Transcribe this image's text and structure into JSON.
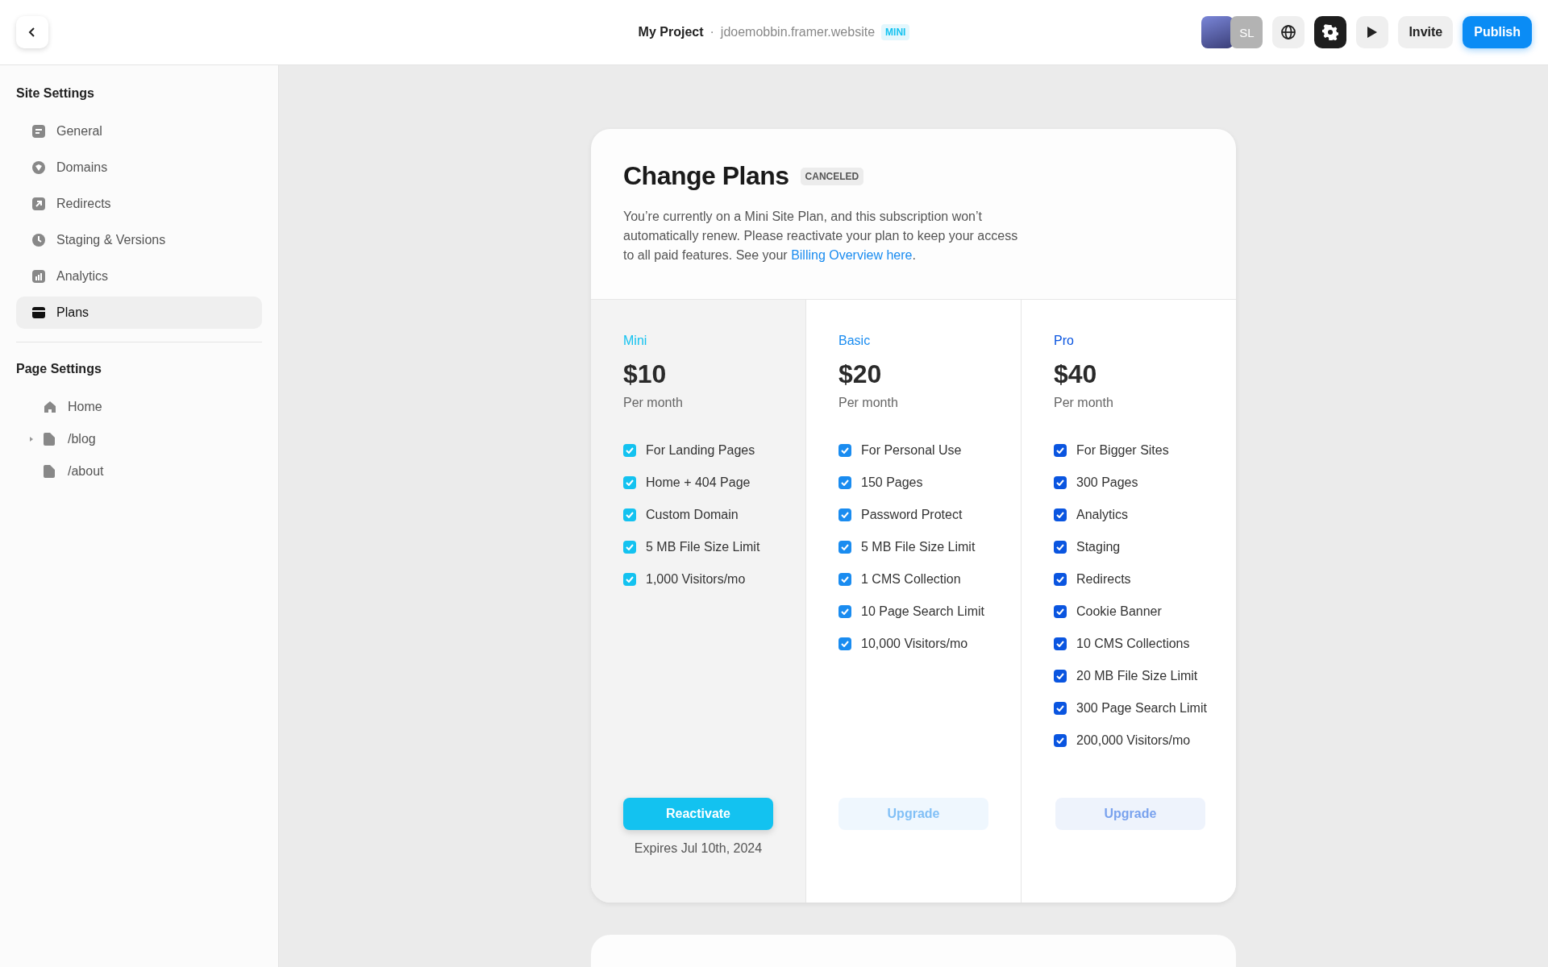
{
  "topbar": {
    "project": "My Project",
    "separator": "·",
    "domain": "jdoemobbin.framer.website",
    "plan_badge": "MINI",
    "avatars": [
      {
        "kind": "photo"
      },
      {
        "kind": "initials",
        "text": "SL"
      }
    ],
    "settings_selected": true,
    "invite": "Invite",
    "publish": "Publish"
  },
  "sidebar": {
    "site_heading": "Site Settings",
    "site_items": [
      {
        "label": "General",
        "selected": false
      },
      {
        "label": "Domains",
        "selected": false
      },
      {
        "label": "Redirects",
        "selected": false
      },
      {
        "label": "Staging & Versions",
        "selected": false
      },
      {
        "label": "Analytics",
        "selected": false
      },
      {
        "label": "Plans",
        "selected": true
      }
    ],
    "page_heading": "Page Settings",
    "pages": [
      {
        "label": "Home",
        "kind": "home"
      },
      {
        "label": "/blog",
        "kind": "page",
        "expanded": false
      },
      {
        "label": "/about",
        "kind": "page"
      }
    ]
  },
  "card": {
    "title": "Change Plans",
    "status": "CANCELED",
    "description": "You’re currently on a Mini Site Plan, and this subscription won’t automatically renew. Please reactivate your plan to keep your access to all paid features. See your ",
    "link": "Billing Overview here",
    "description_end": ".",
    "plans": [
      {
        "name": "Mini",
        "color": "#13c2f0",
        "price": "$10",
        "period": "Per month",
        "selected": true,
        "features": [
          {
            "text": "For Landing Pages",
            "checked": true
          },
          {
            "text": "Home + 404 Page",
            "checked": true
          },
          {
            "text": "Custom Domain",
            "checked": true
          },
          {
            "text": "5 MB File Size Limit",
            "checked": true
          },
          {
            "text": "1,000 Visitors/mo",
            "checked": true
          }
        ],
        "button": {
          "kind": "reactivate",
          "label": "Reactivate",
          "disabled": false
        },
        "note": "Expires Jul 10th, 2024"
      },
      {
        "name": "Basic",
        "color": "#1a8cf0",
        "price": "$20",
        "period": "Per month",
        "selected": false,
        "features": [
          {
            "text": "For Personal Use",
            "checked": true
          },
          {
            "text": "150 Pages",
            "checked": true
          },
          {
            "text": "Password Protect",
            "checked": true
          },
          {
            "text": "5 MB File Size Limit",
            "checked": true
          },
          {
            "text": "1 CMS Collection",
            "checked": true
          },
          {
            "text": "10 Page Search Limit",
            "checked": true
          },
          {
            "text": "10,000 Visitors/mo",
            "checked": true
          }
        ],
        "button": {
          "kind": "upgrade",
          "label": "Upgrade",
          "disabled": true
        }
      },
      {
        "name": "Pro",
        "color": "#0a55e0",
        "price": "$40",
        "period": "Per month",
        "selected": false,
        "features": [
          {
            "text": "For Bigger Sites",
            "checked": true
          },
          {
            "text": "300 Pages",
            "checked": true
          },
          {
            "text": "Analytics",
            "checked": true
          },
          {
            "text": "Staging",
            "checked": true
          },
          {
            "text": "Redirects",
            "checked": true
          },
          {
            "text": "Cookie Banner",
            "checked": true
          },
          {
            "text": "10 CMS Collections",
            "checked": true
          },
          {
            "text": "20 MB File Size Limit",
            "checked": true
          },
          {
            "text": "300 Page Search Limit",
            "checked": true
          },
          {
            "text": "200,000 Visitors/mo",
            "checked": true
          }
        ],
        "button": {
          "kind": "upgrade",
          "label": "Upgrade",
          "disabled": true
        }
      }
    ]
  }
}
